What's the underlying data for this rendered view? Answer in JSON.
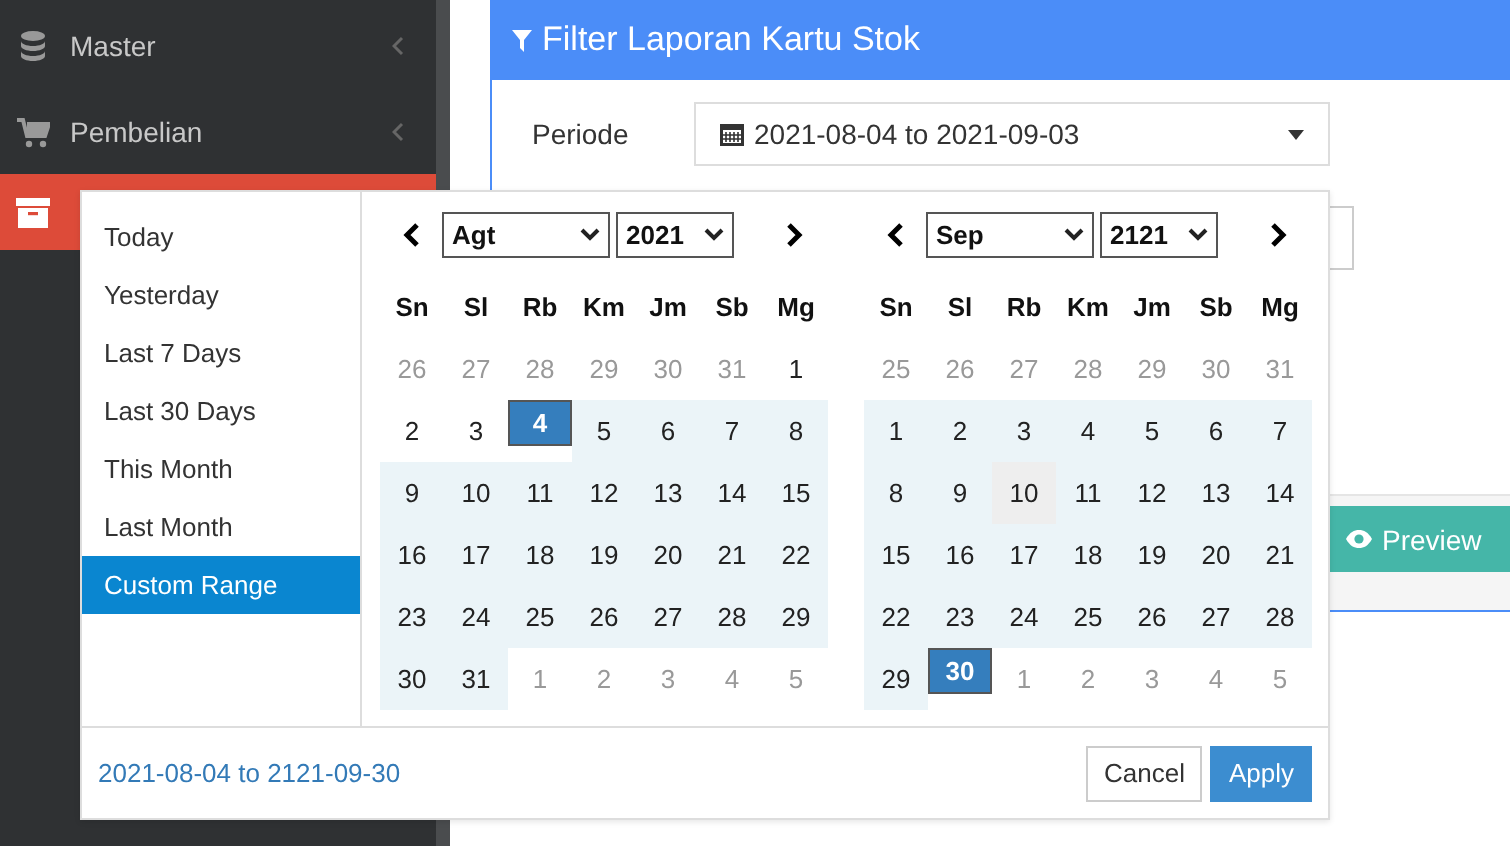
{
  "sidebar": {
    "items": [
      {
        "label": "Master",
        "selected": false,
        "has_children": true
      },
      {
        "label": "Pembelian",
        "selected": false,
        "has_children": true
      },
      {
        "selected": true,
        "has_children": false
      }
    ]
  },
  "panel": {
    "title": "Filter Laporan Kartu Stok",
    "fields": [
      {
        "label": "Periode",
        "value": "2021-08-04 to 2021-09-03"
      }
    ],
    "preview_button": "Preview"
  },
  "date_picker": {
    "ranges": [
      {
        "label": "Today",
        "selected": false
      },
      {
        "label": "Yesterday",
        "selected": false
      },
      {
        "label": "Last 7 Days",
        "selected": false
      },
      {
        "label": "Last 30 Days",
        "selected": false
      },
      {
        "label": "This Month",
        "selected": false
      },
      {
        "label": "Last Month",
        "selected": false
      },
      {
        "label": "Custom Range",
        "selected": true
      }
    ],
    "calendars": [
      {
        "month": "Agt",
        "year": "2021",
        "weekdays": [
          "Sn",
          "Sl",
          "Rb",
          "Km",
          "Jm",
          "Sb",
          "Mg"
        ],
        "weeks": [
          [
            {
              "d": "26",
              "kind": "off"
            },
            {
              "d": "27",
              "kind": "off"
            },
            {
              "d": "28",
              "kind": "off"
            },
            {
              "d": "29",
              "kind": "off"
            },
            {
              "d": "30",
              "kind": "off"
            },
            {
              "d": "31",
              "kind": "off"
            },
            {
              "d": "1",
              "kind": "plain"
            }
          ],
          [
            {
              "d": "2",
              "kind": "plain"
            },
            {
              "d": "3",
              "kind": "plain"
            },
            {
              "d": "4",
              "kind": "start"
            },
            {
              "d": "5",
              "kind": "range"
            },
            {
              "d": "6",
              "kind": "range"
            },
            {
              "d": "7",
              "kind": "range"
            },
            {
              "d": "8",
              "kind": "range"
            }
          ],
          [
            {
              "d": "9",
              "kind": "range"
            },
            {
              "d": "10",
              "kind": "range"
            },
            {
              "d": "11",
              "kind": "range"
            },
            {
              "d": "12",
              "kind": "range"
            },
            {
              "d": "13",
              "kind": "range"
            },
            {
              "d": "14",
              "kind": "range"
            },
            {
              "d": "15",
              "kind": "range"
            }
          ],
          [
            {
              "d": "16",
              "kind": "range"
            },
            {
              "d": "17",
              "kind": "range"
            },
            {
              "d": "18",
              "kind": "range"
            },
            {
              "d": "19",
              "kind": "range"
            },
            {
              "d": "20",
              "kind": "range"
            },
            {
              "d": "21",
              "kind": "range"
            },
            {
              "d": "22",
              "kind": "range"
            }
          ],
          [
            {
              "d": "23",
              "kind": "range"
            },
            {
              "d": "24",
              "kind": "range"
            },
            {
              "d": "25",
              "kind": "range"
            },
            {
              "d": "26",
              "kind": "range"
            },
            {
              "d": "27",
              "kind": "range"
            },
            {
              "d": "28",
              "kind": "range"
            },
            {
              "d": "29",
              "kind": "range"
            }
          ],
          [
            {
              "d": "30",
              "kind": "range"
            },
            {
              "d": "31",
              "kind": "range"
            },
            {
              "d": "1",
              "kind": "off"
            },
            {
              "d": "2",
              "kind": "off"
            },
            {
              "d": "3",
              "kind": "off"
            },
            {
              "d": "4",
              "kind": "off"
            },
            {
              "d": "5",
              "kind": "off"
            }
          ]
        ]
      },
      {
        "month": "Sep",
        "year": "2121",
        "weekdays": [
          "Sn",
          "Sl",
          "Rb",
          "Km",
          "Jm",
          "Sb",
          "Mg"
        ],
        "weeks": [
          [
            {
              "d": "25",
              "kind": "off"
            },
            {
              "d": "26",
              "kind": "off"
            },
            {
              "d": "27",
              "kind": "off"
            },
            {
              "d": "28",
              "kind": "off"
            },
            {
              "d": "29",
              "kind": "off"
            },
            {
              "d": "30",
              "kind": "off"
            },
            {
              "d": "31",
              "kind": "off"
            }
          ],
          [
            {
              "d": "1",
              "kind": "range"
            },
            {
              "d": "2",
              "kind": "range"
            },
            {
              "d": "3",
              "kind": "range"
            },
            {
              "d": "4",
              "kind": "range"
            },
            {
              "d": "5",
              "kind": "range"
            },
            {
              "d": "6",
              "kind": "range"
            },
            {
              "d": "7",
              "kind": "range"
            }
          ],
          [
            {
              "d": "8",
              "kind": "range"
            },
            {
              "d": "9",
              "kind": "range"
            },
            {
              "d": "10",
              "kind": "hover"
            },
            {
              "d": "11",
              "kind": "range"
            },
            {
              "d": "12",
              "kind": "range"
            },
            {
              "d": "13",
              "kind": "range"
            },
            {
              "d": "14",
              "kind": "range"
            }
          ],
          [
            {
              "d": "15",
              "kind": "range"
            },
            {
              "d": "16",
              "kind": "range"
            },
            {
              "d": "17",
              "kind": "range"
            },
            {
              "d": "18",
              "kind": "range"
            },
            {
              "d": "19",
              "kind": "range"
            },
            {
              "d": "20",
              "kind": "range"
            },
            {
              "d": "21",
              "kind": "range"
            }
          ],
          [
            {
              "d": "22",
              "kind": "range"
            },
            {
              "d": "23",
              "kind": "range"
            },
            {
              "d": "24",
              "kind": "range"
            },
            {
              "d": "25",
              "kind": "range"
            },
            {
              "d": "26",
              "kind": "range"
            },
            {
              "d": "27",
              "kind": "range"
            },
            {
              "d": "28",
              "kind": "range"
            }
          ],
          [
            {
              "d": "29",
              "kind": "range"
            },
            {
              "d": "30",
              "kind": "end"
            },
            {
              "d": "1",
              "kind": "off"
            },
            {
              "d": "2",
              "kind": "off"
            },
            {
              "d": "3",
              "kind": "off"
            },
            {
              "d": "4",
              "kind": "off"
            },
            {
              "d": "5",
              "kind": "off"
            }
          ]
        ]
      }
    ],
    "selected_text": "2021-08-04 to 2121-09-30",
    "cancel_button": "Cancel",
    "apply_button": "Apply"
  }
}
